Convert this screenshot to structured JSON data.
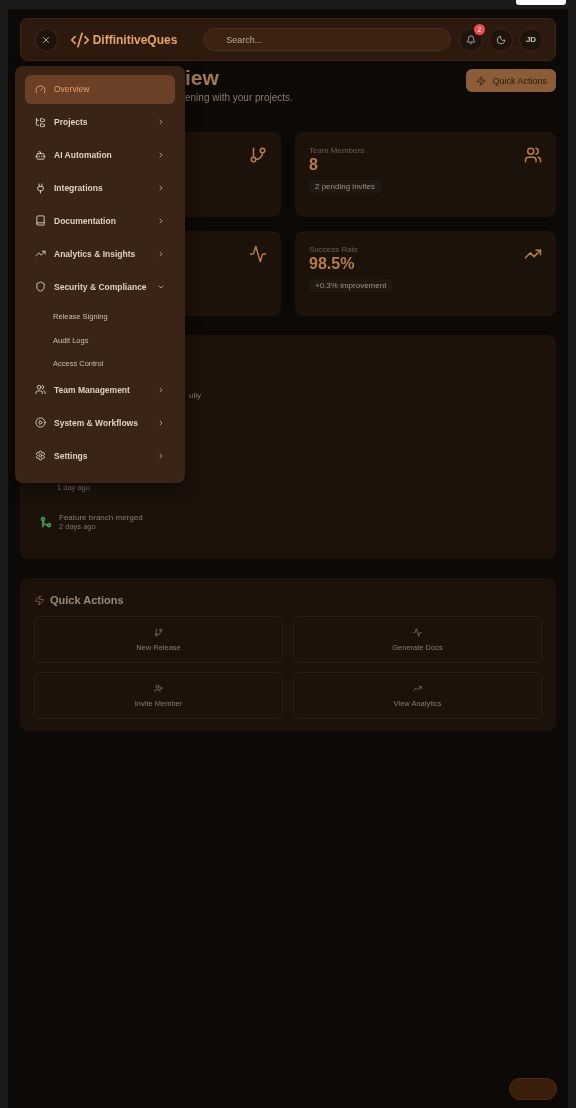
{
  "header": {
    "brand": "DiffinitiveQues",
    "search": {
      "placeholder": "Search..."
    },
    "notifications": "2",
    "avatar": "JD"
  },
  "page": {
    "title": "iew",
    "subtitle": "ening with your projects.",
    "action": "Quick Actions"
  },
  "stats": [
    {
      "kind": "icon-only"
    },
    {
      "kind": "full",
      "label": "Team Members",
      "value": "8",
      "note": "2 pending invites"
    },
    {
      "kind": "icon-only"
    },
    {
      "kind": "full",
      "label": "Success Rate",
      "value": "98.5%",
      "note": "+0.3% improvement"
    }
  ],
  "activity": [
    {
      "title": "ully"
    },
    {
      "time": "1 day ago"
    },
    {
      "title": "Feature branch merged",
      "time": "2 days ago",
      "color": "#3f9a4e"
    }
  ],
  "quick_actions": {
    "title": "Quick Actions",
    "items": [
      {
        "label": "New Release"
      },
      {
        "label": "Generate Docs"
      },
      {
        "label": "Invite Member"
      },
      {
        "label": "View Analytics"
      }
    ]
  },
  "menu": {
    "items": [
      {
        "label": "Overview",
        "selected": true
      },
      {
        "label": "Projects",
        "selected": false,
        "expanded": false
      },
      {
        "label": "AI Automation",
        "selected": false,
        "expanded": false
      },
      {
        "label": "Integrations",
        "selected": false,
        "expanded": false
      },
      {
        "label": "Documentation",
        "selected": false,
        "expanded": false
      },
      {
        "label": "Analytics & Insights",
        "selected": false,
        "expanded": false
      },
      {
        "label": "Security & Compliance",
        "selected": false,
        "expanded": true,
        "children": [
          {
            "label": "Release Signing"
          },
          {
            "label": "Audit Logs"
          },
          {
            "label": "Access Control"
          }
        ]
      },
      {
        "label": "Team Management",
        "selected": false,
        "expanded": false
      },
      {
        "label": "System & Workflows",
        "selected": false,
        "expanded": false
      },
      {
        "label": "Settings",
        "selected": false,
        "expanded": false
      }
    ]
  }
}
